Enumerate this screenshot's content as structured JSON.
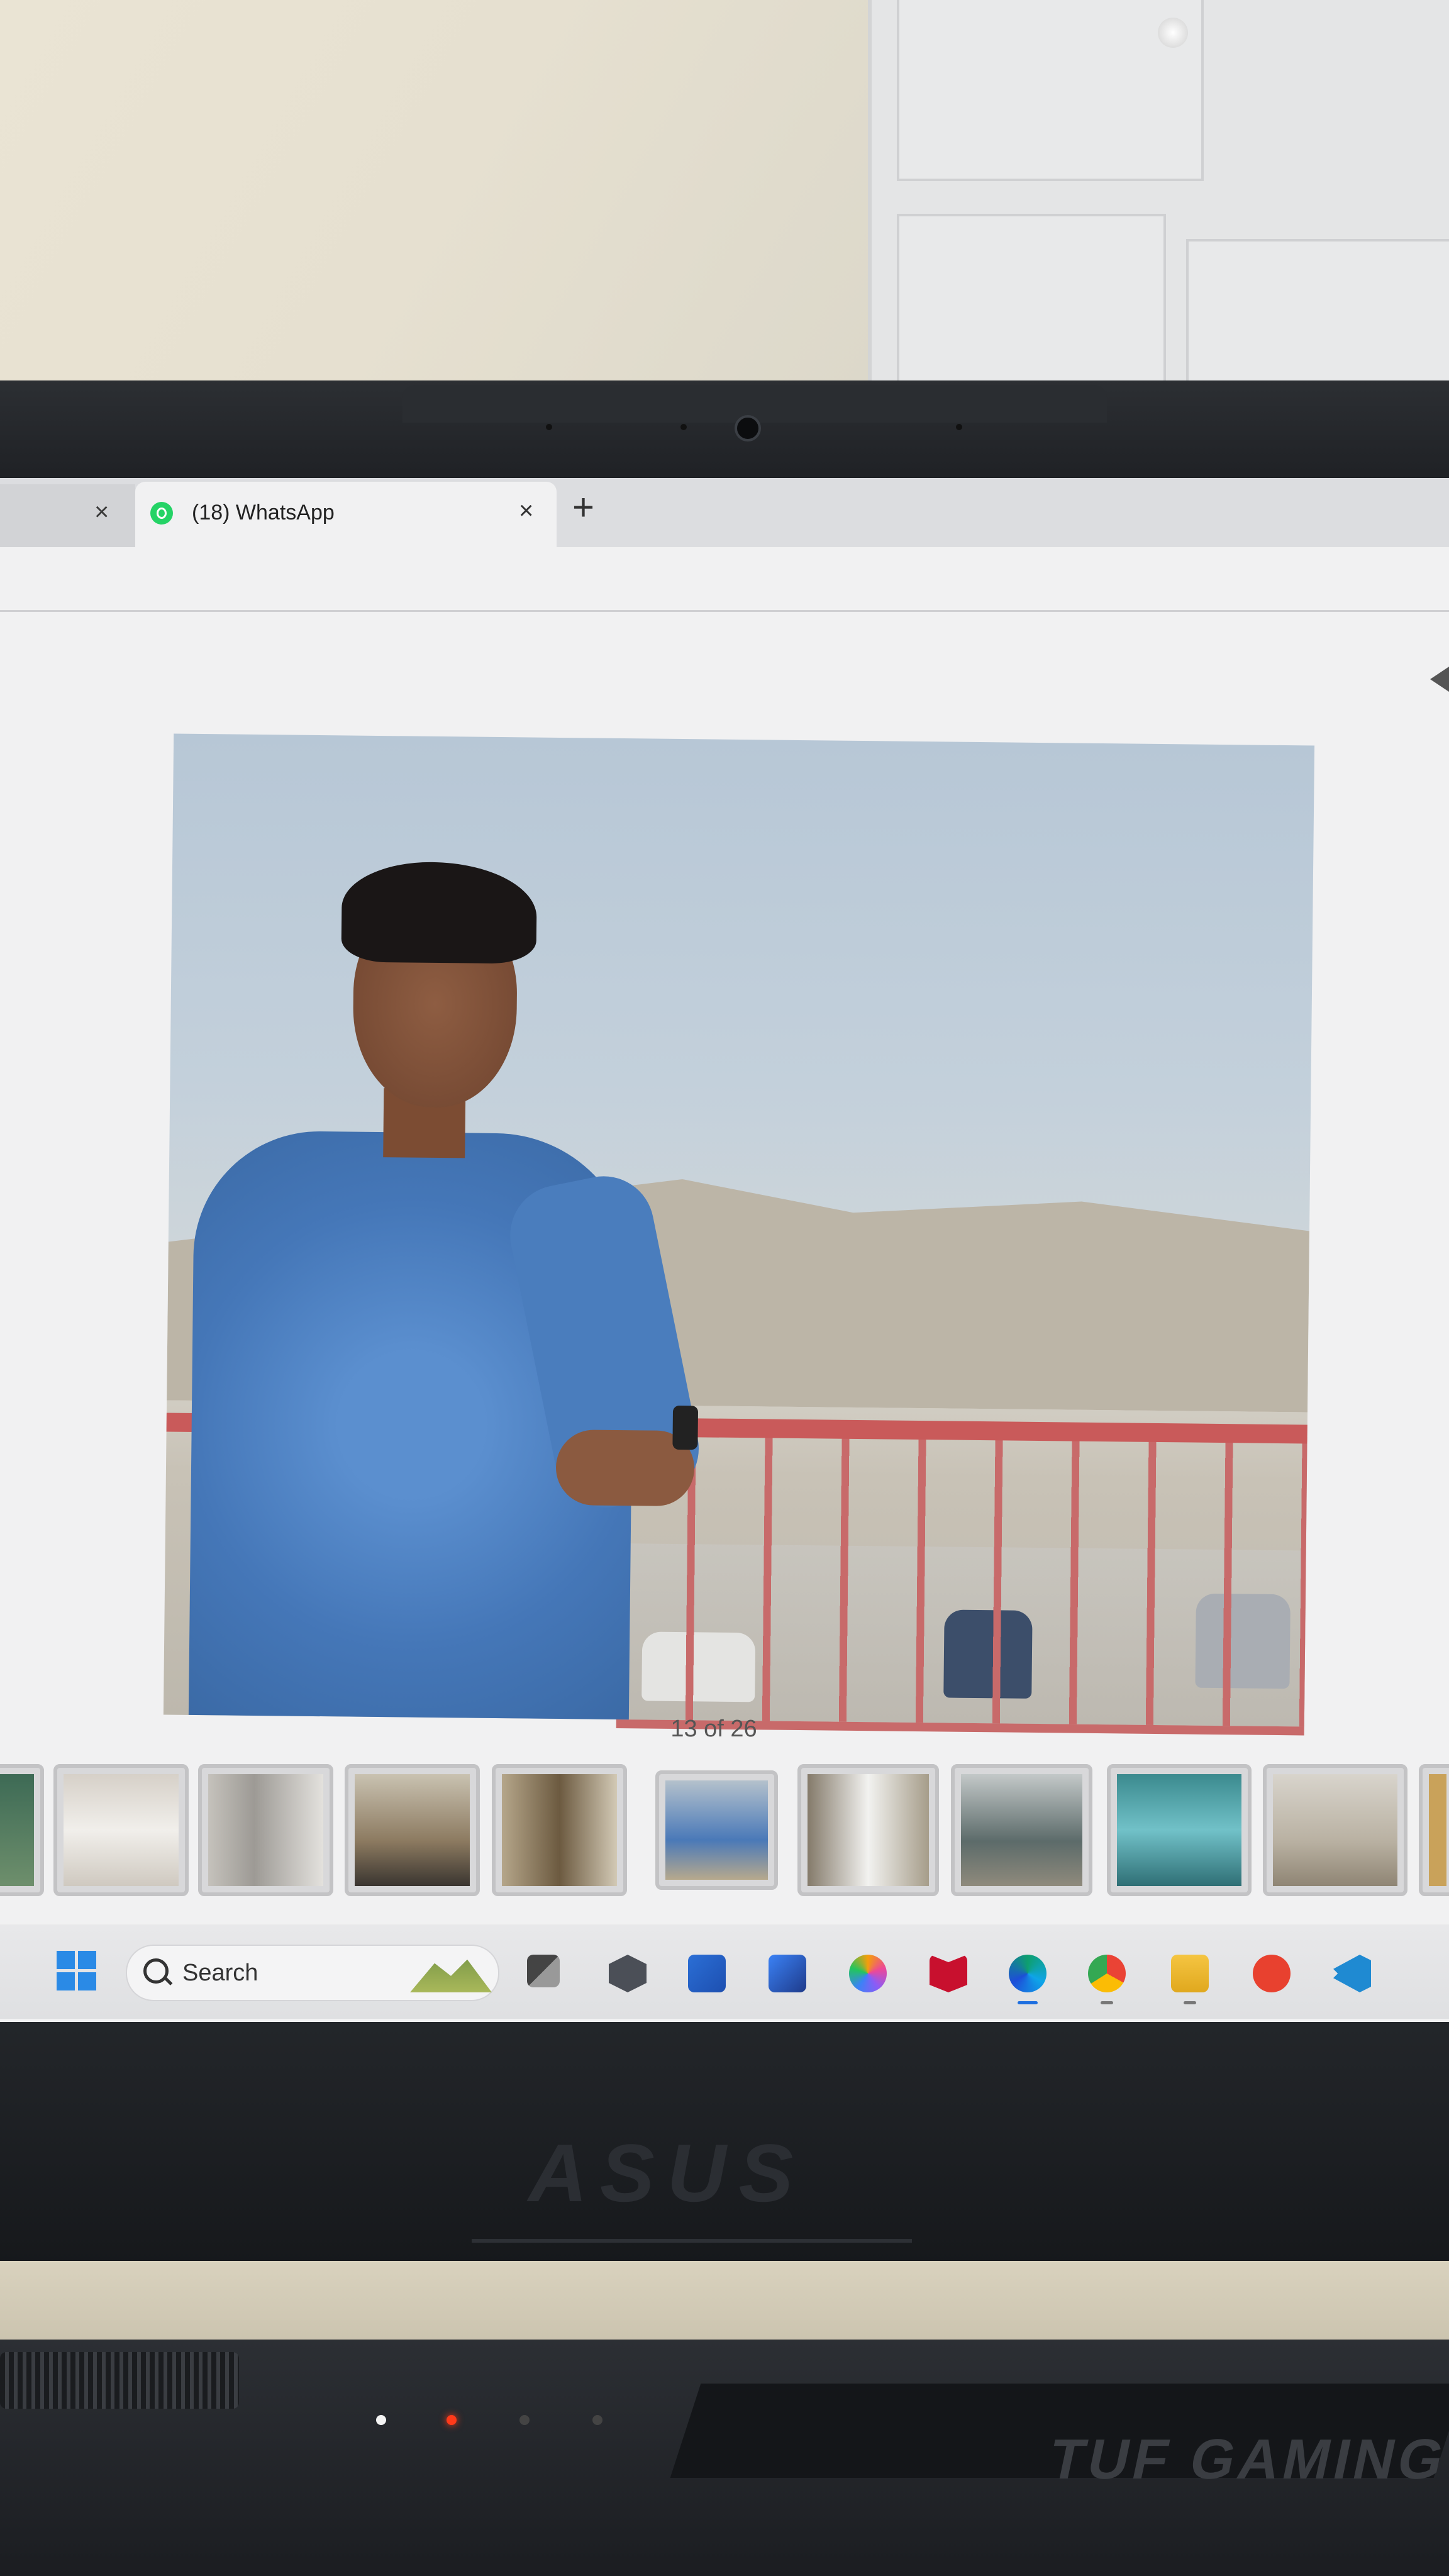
{
  "browser": {
    "active_tab_title": "(18) WhatsApp",
    "prev_tab_close": "×",
    "tab_close": "×",
    "new_tab": "+"
  },
  "viewer": {
    "counter": "13 of 26",
    "thumbnail_count": 11
  },
  "taskbar": {
    "search_label": "Search",
    "icons": [
      "task-view-icon",
      "app-icon",
      "microsoft-store-icon",
      "text-app-icon",
      "copilot-icon",
      "mcafee-icon",
      "edge-icon",
      "chrome-icon",
      "file-explorer-icon",
      "wps-office-icon",
      "vscode-icon"
    ]
  },
  "hardware": {
    "brand": "ASUS",
    "series": "TUF GAMING"
  },
  "colors": {
    "whatsapp": "#25d366",
    "windows_blue": "#2a8ae6",
    "led_red": "#ff3a1a"
  }
}
